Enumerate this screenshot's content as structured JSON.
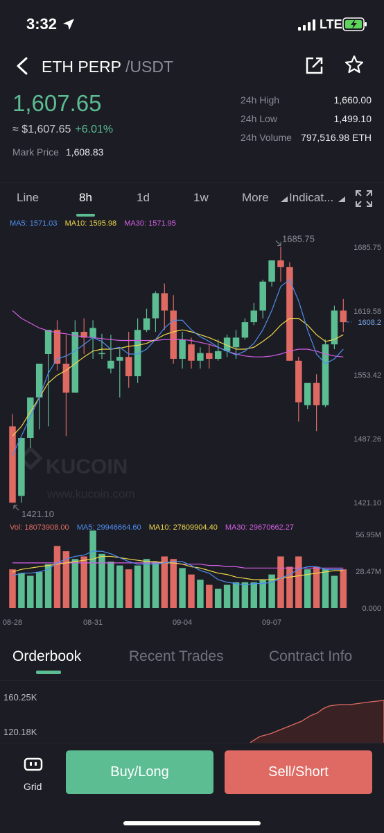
{
  "status_bar": {
    "time": "3:32",
    "network": "LTE"
  },
  "header": {
    "base": "ETH PERP",
    "quote": "/USDT"
  },
  "price": {
    "last": "1,607.65",
    "approx": "≈ $1,607.65",
    "change": "+6.01%",
    "mark_label": "Mark Price",
    "mark_value": "1,608.83"
  },
  "stats": [
    {
      "label": "24h High",
      "value": "1,660.00"
    },
    {
      "label": "24h Low",
      "value": "1,499.10"
    },
    {
      "label": "24h Volume",
      "value": "797,516.98 ETH"
    }
  ],
  "timeframes": [
    "Line",
    "8h",
    "1d",
    "1w",
    "More",
    "Indicat..."
  ],
  "active_timeframe": "8h",
  "ma_legend": {
    "ma5": "MA5: 1571.03",
    "ma10": "MA10: 1595.98",
    "ma30": "MA30: 1571.95"
  },
  "vol_legend": {
    "vol": "Vol: 18073908.00",
    "ma5": "MA5: 29946664.60",
    "ma10": "MA10: 27609904.40",
    "ma30": "MA30: 29670662.27"
  },
  "watermark": {
    "brand": "KUCOIN",
    "url": "www.kucoin.com"
  },
  "colors": {
    "up": "#5cbc92",
    "down": "#de6a63",
    "ma5": "#4e8df0",
    "ma10": "#f0d64a",
    "ma30": "#d45ee6",
    "accent": "#5cbc92"
  },
  "chart_data": {
    "type": "candlestick",
    "price_axis_labels": [
      "1685.75",
      "1619.58",
      "1553.42",
      "1487.26",
      "1421.10"
    ],
    "ylim": [
      1421.1,
      1685.75
    ],
    "current_price_label": "1608.2",
    "current_price": 1608.2,
    "high_marker": "1685.75",
    "low_marker": "1421.10",
    "date_labels": [
      {
        "text": "08-28",
        "index": 0
      },
      {
        "text": "08-31",
        "index": 9
      },
      {
        "text": "09-04",
        "index": 19
      },
      {
        "text": "09-07",
        "index": 29
      }
    ],
    "candles": [
      {
        "o": 1500,
        "h": 1513,
        "l": 1421,
        "c": 1421
      },
      {
        "o": 1428,
        "h": 1488,
        "l": 1421,
        "c": 1488
      },
      {
        "o": 1488,
        "h": 1530,
        "l": 1478,
        "c": 1530
      },
      {
        "o": 1530,
        "h": 1565,
        "l": 1497,
        "c": 1565
      },
      {
        "o": 1575,
        "h": 1600,
        "l": 1500,
        "c": 1600
      },
      {
        "o": 1600,
        "h": 1610,
        "l": 1558,
        "c": 1565
      },
      {
        "o": 1565,
        "h": 1595,
        "l": 1490,
        "c": 1535
      },
      {
        "o": 1535,
        "h": 1610,
        "l": 1535,
        "c": 1598
      },
      {
        "o": 1598,
        "h": 1612,
        "l": 1575,
        "c": 1592
      },
      {
        "o": 1592,
        "h": 1610,
        "l": 1570,
        "c": 1602
      },
      {
        "o": 1576,
        "h": 1596,
        "l": 1570,
        "c": 1576
      },
      {
        "o": 1560,
        "h": 1595,
        "l": 1555,
        "c": 1568
      },
      {
        "o": 1568,
        "h": 1580,
        "l": 1530,
        "c": 1572
      },
      {
        "o": 1572,
        "h": 1598,
        "l": 1540,
        "c": 1552
      },
      {
        "o": 1552,
        "h": 1612,
        "l": 1545,
        "c": 1600
      },
      {
        "o": 1600,
        "h": 1622,
        "l": 1598,
        "c": 1612
      },
      {
        "o": 1612,
        "h": 1640,
        "l": 1598,
        "c": 1638
      },
      {
        "o": 1638,
        "h": 1648,
        "l": 1600,
        "c": 1620
      },
      {
        "o": 1620,
        "h": 1636,
        "l": 1565,
        "c": 1570
      },
      {
        "o": 1570,
        "h": 1598,
        "l": 1560,
        "c": 1590
      },
      {
        "o": 1585,
        "h": 1592,
        "l": 1560,
        "c": 1568
      },
      {
        "o": 1568,
        "h": 1582,
        "l": 1560,
        "c": 1576
      },
      {
        "o": 1576,
        "h": 1585,
        "l": 1560,
        "c": 1570
      },
      {
        "o": 1570,
        "h": 1590,
        "l": 1568,
        "c": 1578
      },
      {
        "o": 1578,
        "h": 1595,
        "l": 1572,
        "c": 1592
      },
      {
        "o": 1582,
        "h": 1600,
        "l": 1570,
        "c": 1592
      },
      {
        "o": 1592,
        "h": 1612,
        "l": 1590,
        "c": 1608
      },
      {
        "o": 1608,
        "h": 1628,
        "l": 1605,
        "c": 1620
      },
      {
        "o": 1620,
        "h": 1652,
        "l": 1612,
        "c": 1650
      },
      {
        "o": 1650,
        "h": 1672,
        "l": 1645,
        "c": 1672
      },
      {
        "o": 1672,
        "h": 1686,
        "l": 1650,
        "c": 1665
      },
      {
        "o": 1665,
        "h": 1670,
        "l": 1568,
        "c": 1568
      },
      {
        "o": 1568,
        "h": 1572,
        "l": 1505,
        "c": 1525
      },
      {
        "o": 1522,
        "h": 1530,
        "l": 1518,
        "c": 1545
      },
      {
        "o": 1545,
        "h": 1554,
        "l": 1495,
        "c": 1522
      },
      {
        "o": 1522,
        "h": 1590,
        "l": 1520,
        "c": 1585
      },
      {
        "o": 1585,
        "h": 1625,
        "l": 1580,
        "c": 1620
      },
      {
        "o": 1620,
        "h": 1632,
        "l": 1598,
        "c": 1608
      }
    ],
    "ma5": [
      1470,
      1490,
      1510,
      1530,
      1555,
      1570,
      1573,
      1578,
      1585,
      1592,
      1588,
      1580,
      1582,
      1575,
      1575,
      1580,
      1590,
      1602,
      1610,
      1610,
      1600,
      1593,
      1588,
      1582,
      1578,
      1574,
      1578,
      1586,
      1600,
      1620,
      1645,
      1652,
      1630,
      1600,
      1575,
      1565,
      1570,
      1580
    ],
    "ma10": [
      1490,
      1500,
      1515,
      1530,
      1545,
      1553,
      1558,
      1565,
      1572,
      1578,
      1580,
      1580,
      1581,
      1583,
      1584,
      1586,
      1590,
      1595,
      1598,
      1600,
      1598,
      1595,
      1592,
      1588,
      1584,
      1580,
      1580,
      1582,
      1588,
      1595,
      1605,
      1612,
      1612,
      1605,
      1595,
      1588,
      1590,
      1595
    ],
    "ma30": [
      1620,
      1612,
      1607,
      1602,
      1599,
      1597,
      1596,
      1594,
      1593,
      1592,
      1591,
      1590,
      1589,
      1589,
      1589,
      1589,
      1589,
      1590,
      1590,
      1590,
      1589,
      1587,
      1585,
      1582,
      1578,
      1575,
      1573,
      1572,
      1572,
      1573,
      1575,
      1578,
      1580,
      1580,
      1578,
      1575,
      1573,
      1572
    ],
    "volume_axis_labels": [
      "56.95M",
      "28.47M",
      "0.000"
    ],
    "vlim": [
      0,
      56950000
    ],
    "volume": [
      30,
      27,
      25,
      28,
      34,
      48,
      44,
      38,
      40,
      60,
      42,
      36,
      33,
      30,
      33,
      38,
      36,
      40,
      38,
      31,
      26,
      22,
      18,
      15,
      18,
      20,
      20,
      20,
      22,
      26,
      40,
      32,
      40,
      30,
      32,
      30,
      25,
      30,
      22
    ],
    "vol_ma5": [
      25,
      27,
      27,
      28,
      30,
      35,
      38,
      40,
      41,
      44,
      44,
      42,
      39,
      36,
      34,
      34,
      34,
      35,
      36,
      36,
      33,
      29,
      27,
      22,
      20,
      19,
      18,
      19,
      19,
      20,
      23,
      26,
      30,
      32,
      32,
      30,
      30,
      30,
      28
    ],
    "vol_ma10": [
      28,
      30,
      31,
      32,
      33,
      34,
      35,
      36,
      37,
      38,
      40,
      40,
      39,
      38,
      37,
      36,
      36,
      35,
      35,
      34,
      32,
      31,
      29,
      27,
      26,
      24,
      23,
      22,
      22,
      22,
      23,
      24,
      25,
      26,
      27,
      28,
      29,
      29,
      28
    ],
    "vol_ma30": [
      35,
      35,
      35,
      35,
      35,
      35,
      35,
      35,
      35,
      35,
      35,
      35,
      35,
      35,
      35,
      35,
      35,
      35,
      35,
      34,
      34,
      34,
      33,
      33,
      32,
      32,
      31,
      31,
      31,
      31,
      31,
      31,
      31,
      31,
      31,
      31,
      31,
      31,
      31
    ]
  },
  "info_tabs": [
    "Orderbook",
    "Recent Trades",
    "Contract Info"
  ],
  "orderbook": {
    "labels": [
      "160.25K",
      "120.18K"
    ]
  },
  "actions": {
    "grid_label": "Grid",
    "buy_label": "Buy/Long",
    "sell_label": "Sell/Short"
  }
}
